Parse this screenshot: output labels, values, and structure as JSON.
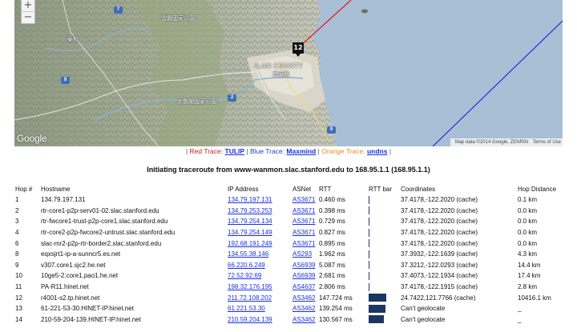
{
  "map": {
    "zoom_in": "+",
    "zoom_out": "−",
    "marker_label": "12",
    "labels": {
      "county": "ILAN COUNTY",
      "county_cn": "宜蘭縣",
      "town": "泰和",
      "park": "雪霸國家公園",
      "park2": "太魯閣國家公園"
    },
    "route_shields": [
      "7",
      "9",
      "2",
      "9"
    ],
    "google_logo": "Google",
    "attribution": "Map data ©2014 Google, ZENRIN",
    "terms": "Terms of Use",
    "colors": {
      "sea": "#a9bfd6",
      "red_trace": "#e8121d",
      "blue_trace": "#1b2fd6"
    }
  },
  "legend": {
    "lead_sep": "|",
    "red_label": "Red Trace:",
    "red_link": "TULIP",
    "sep1": "|",
    "blue_label": "Blue Trace:",
    "blue_link": "Maxmind",
    "sep2": "|",
    "orange_label": "Orange Trace:",
    "orange_link": "undns",
    "trail_sep": "|"
  },
  "title": "Initiating traceroute from www-wanmon.slac.stanford.edu to 168.95.1.1 (168.95.1.1)",
  "table": {
    "headers": {
      "hop": "Hop #",
      "hostname": "Hostname",
      "ip": "IP Address",
      "asnet": "ASNet",
      "rtt": "RTT",
      "rttbar": "RTT bar",
      "coords": "Coordinates",
      "distance": "Hop Distance"
    },
    "rows": [
      {
        "hop": "1",
        "hostname": "134.79.197.131",
        "ip": "",
        "asnet": "",
        "rtt": "",
        "rtt_ms": 0,
        "coords": "",
        "distance": ""
      },
      {
        "hop": "2",
        "hostname": "rtr-core1-p2p-serv01-02.slac.stanford.edu",
        "ip": "134.79.253.253",
        "asnet": "AS3671",
        "rtt": "0.398 ms",
        "rtt_ms": 0.398,
        "coords": "37.4178,-122.2020 (cache)",
        "distance": "0.0 km"
      },
      {
        "hop": "3",
        "hostname": "rtr-fwcore1-trust-p2p-core1.slac.stanford.edu",
        "ip": "134.79.254.134",
        "asnet": "AS3671",
        "rtt": "0.729 ms",
        "rtt_ms": 0.729,
        "coords": "37.4178,-122.2020 (cache)",
        "distance": "0.0 km"
      },
      {
        "hop": "4",
        "hostname": "rtr-core2-p2p-fwcore2-untrust.slac.stanford.edu",
        "ip": "134.79.254.149",
        "asnet": "AS3671",
        "rtt": "0.827 ms",
        "rtt_ms": 0.827,
        "coords": "37.4178,-122.2020 (cache)",
        "distance": "0.0 km"
      },
      {
        "hop": "6",
        "hostname": "slac-mr2-p2p-rtr-border2.slac.stanford.edu",
        "ip": "192.68.191.249",
        "asnet": "AS3671",
        "rtt": "0.895 ms",
        "rtt_ms": 0.895,
        "coords": "37.4178,-122.2020 (cache)",
        "distance": "0.0 km"
      },
      {
        "hop": "8",
        "hostname": "eqxsjrt1-ip-a-sunncr5.es.net",
        "ip": "134.55.38.146",
        "asnet": "AS293",
        "rtt": "1.962 ms",
        "rtt_ms": 1.962,
        "coords": "37.3932,-122.1639 (cache)",
        "distance": "4.3 km"
      },
      {
        "hop": "9",
        "hostname": "v307.core1.sjc2.he.net",
        "ip": "66.220.6.249",
        "asnet": "AS6939",
        "rtt": "5.087 ms",
        "rtt_ms": 5.087,
        "coords": "37.3212,-122.0293 (cache)",
        "distance": "14.4 km"
      },
      {
        "hop": "10",
        "hostname": "10ge5-2.core1.pao1.he.net",
        "ip": "72.52.92.69",
        "asnet": "AS6939",
        "rtt": "2.681 ms",
        "rtt_ms": 2.681,
        "coords": "37.4073,-122.1934 (cache)",
        "distance": "17.4 km"
      },
      {
        "hop": "11",
        "hostname": "PA-R11.hinet.net",
        "ip": "198.32.176.195",
        "asnet": "AS4637",
        "rtt": "2.806 ms",
        "rtt_ms": 2.806,
        "coords": "37.4178,-122.1915 (cache)",
        "distance": "2.8 km"
      },
      {
        "hop": "12",
        "hostname": "r4001-s2.tp.hinet.net",
        "ip": "211.72.108.202",
        "asnet": "AS3462",
        "rtt": "147.724 ms",
        "rtt_ms": 147.724,
        "coords": "24.7422,121.7766 (cache)",
        "distance": "10416.1 km"
      },
      {
        "hop": "13",
        "hostname": "61-221-53-30.HINET-IP.hinet.net",
        "ip": "61.221.53.30",
        "asnet": "AS3462",
        "rtt": "139.254 ms",
        "rtt_ms": 139.254,
        "coords": "Can't geolocate",
        "distance": "_"
      },
      {
        "hop": "14",
        "hostname": "210-59-204-139.HINET-IP.hinet.net",
        "ip": "210.59.204.139",
        "asnet": "AS3462",
        "rtt": "130.567 ms",
        "rtt_ms": 130.567,
        "coords": "Can't geolocate",
        "distance": "_"
      }
    ],
    "first_row_fill": {
      "ip": "134.79.197.131",
      "asnet": "AS3671",
      "rtt": "0.460 ms",
      "rtt_ms": 0.46,
      "coords": "37.4178,-122.2020 (cache)",
      "distance": "0.1 km"
    }
  }
}
